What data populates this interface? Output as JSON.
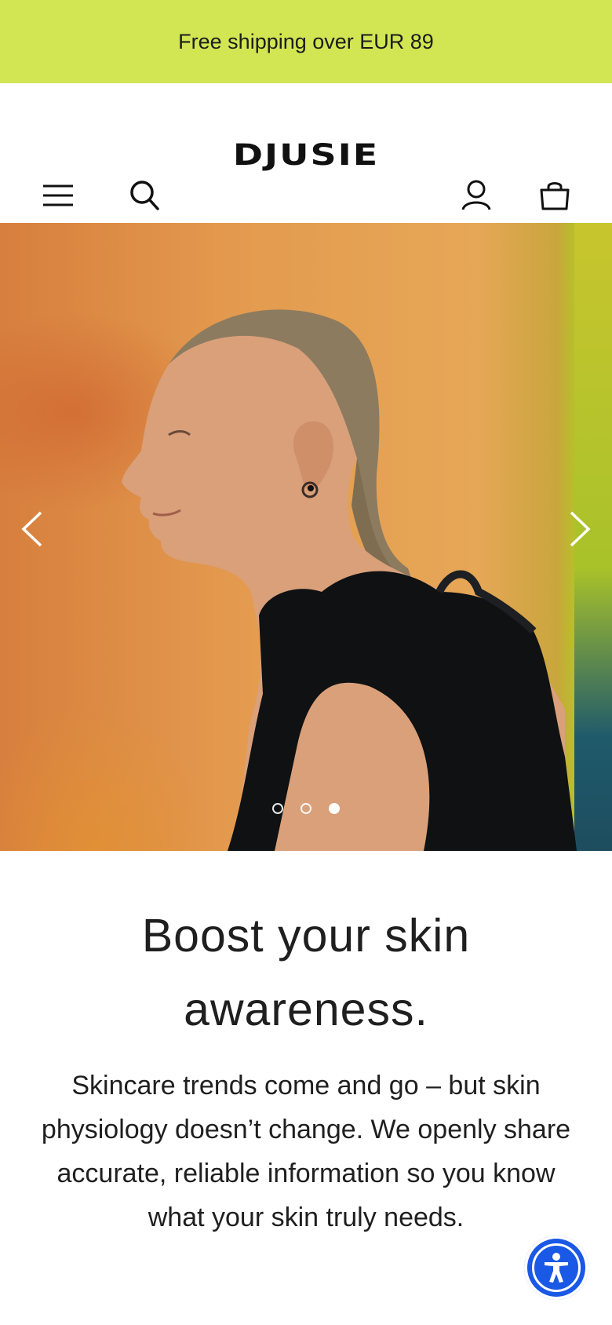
{
  "announcement": {
    "text": "Free shipping over EUR 89"
  },
  "header": {
    "logo": "DJUSIE",
    "icons": {
      "menu": "menu-icon",
      "search": "search-icon",
      "account": "account-icon",
      "cart": "cart-icon"
    }
  },
  "hero": {
    "prev_icon": "chevron-left-icon",
    "next_icon": "chevron-right-icon",
    "slides_count": 3,
    "active_slide": 3
  },
  "content": {
    "headline": "Boost your skin awareness.",
    "body": "Skincare trends come and go – but skin physiology doesn’t change. We openly share accurate, reliable information so you know what your skin truly needs."
  },
  "accessibility": {
    "icon": "accessibility-icon"
  },
  "colors": {
    "announcement_bg": "#d2e653",
    "accessibility_button": "#1a58e6",
    "text": "#1f1f1f"
  }
}
